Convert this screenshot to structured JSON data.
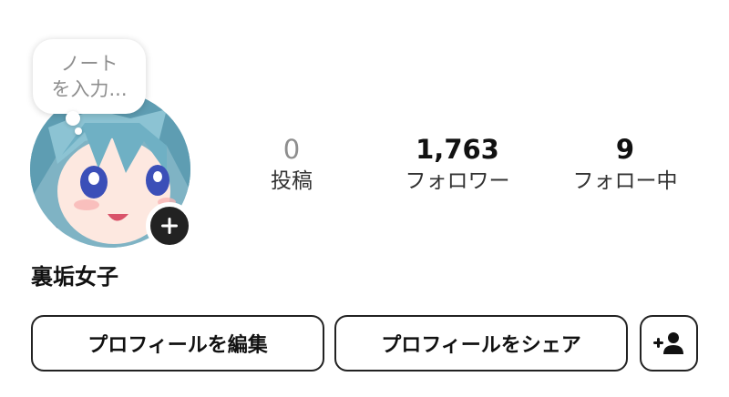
{
  "note": {
    "line1": "ノート",
    "line2": "を入力..."
  },
  "stats": [
    {
      "value": "0",
      "label": "投稿"
    },
    {
      "value": "1,763",
      "label": "フォロワー"
    },
    {
      "value": "9",
      "label": "フォロー中"
    }
  ],
  "profile": {
    "username": "裏垢女子"
  },
  "buttons": {
    "edit_profile": "プロフィールを編集",
    "share_profile": "プロフィールをシェア"
  }
}
